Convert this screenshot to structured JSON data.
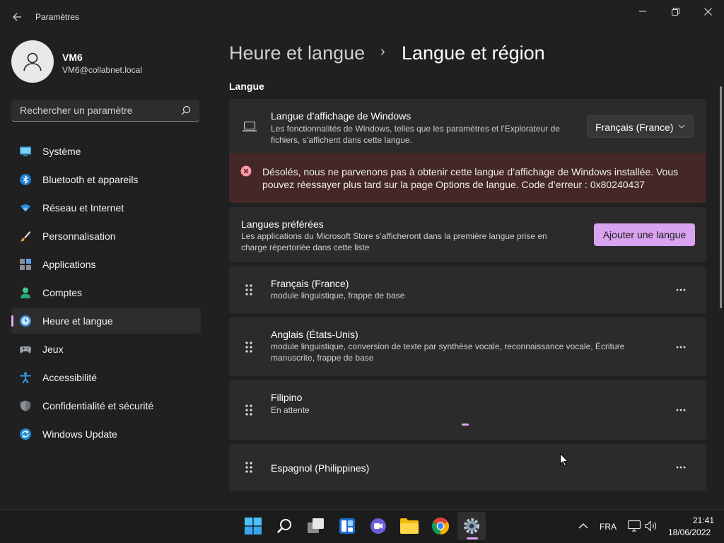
{
  "window": {
    "title": "Paramètres",
    "back_icon": "back-arrow-icon",
    "minimize_icon": "minimize-icon",
    "restore_icon": "restore-icon",
    "close_icon": "close-icon"
  },
  "user": {
    "name": "VM6",
    "email": "VM6@collabnet.local"
  },
  "search": {
    "placeholder": "Rechercher un paramètre"
  },
  "sidebar": {
    "items": [
      {
        "label": "Système",
        "icon": "system-icon"
      },
      {
        "label": "Bluetooth et appareils",
        "icon": "bluetooth-icon"
      },
      {
        "label": "Réseau et Internet",
        "icon": "wifi-icon"
      },
      {
        "label": "Personnalisation",
        "icon": "brush-icon"
      },
      {
        "label": "Applications",
        "icon": "apps-icon"
      },
      {
        "label": "Comptes",
        "icon": "account-icon"
      },
      {
        "label": "Heure et langue",
        "icon": "time-language-icon",
        "active": true
      },
      {
        "label": "Jeux",
        "icon": "gamepad-icon"
      },
      {
        "label": "Accessibilité",
        "icon": "accessibility-icon"
      },
      {
        "label": "Confidentialité et sécurité",
        "icon": "shield-icon"
      },
      {
        "label": "Windows Update",
        "icon": "update-icon"
      }
    ]
  },
  "breadcrumb": {
    "parent": "Heure et langue",
    "separator": "›",
    "current": "Langue et région"
  },
  "section": {
    "title": "Langue"
  },
  "display_language": {
    "title": "Langue d’affichage de Windows",
    "description": "Les fonctionnalités de Windows, telles que les paramètres et l’Explorateur de fichiers, s’affichent dans cette langue.",
    "selected": "Français (France)"
  },
  "error": {
    "message": "Désolés, nous ne parvenons pas à obtenir cette langue d’affichage de Windows installée. Vous pouvez réessayer plus tard sur la page Options de langue. Code d’erreur : 0x80240437"
  },
  "preferred": {
    "title": "Langues préférées",
    "description": "Les applications du Microsoft Store s’afficheront dans la première langue prise en charge répertoriée dans cette liste",
    "add_button": "Ajouter une langue"
  },
  "languages": [
    {
      "name": "Français (France)",
      "detail": "module linguistique, frappe de base"
    },
    {
      "name": "Anglais (États-Unis)",
      "detail": "module linguistique, conversion de texte par synthèse vocale, reconnaissance vocale, Écriture manuscrite, frappe de base"
    },
    {
      "name": "Filipino",
      "detail": "En attente"
    },
    {
      "name": "Espagnol (Philippines)",
      "detail": ""
    }
  ],
  "taskbar": {
    "apps": [
      "start-icon",
      "search-icon",
      "task-view-icon",
      "widgets-icon",
      "teams-chat-icon",
      "file-explorer-icon",
      "chrome-icon",
      "settings-icon"
    ],
    "language": "FRA",
    "time": "21:41",
    "date": "18/06/2022"
  },
  "colors": {
    "accent": "#d9a3f0",
    "error_bg": "#442726",
    "error_icon": "#ff99a4"
  }
}
